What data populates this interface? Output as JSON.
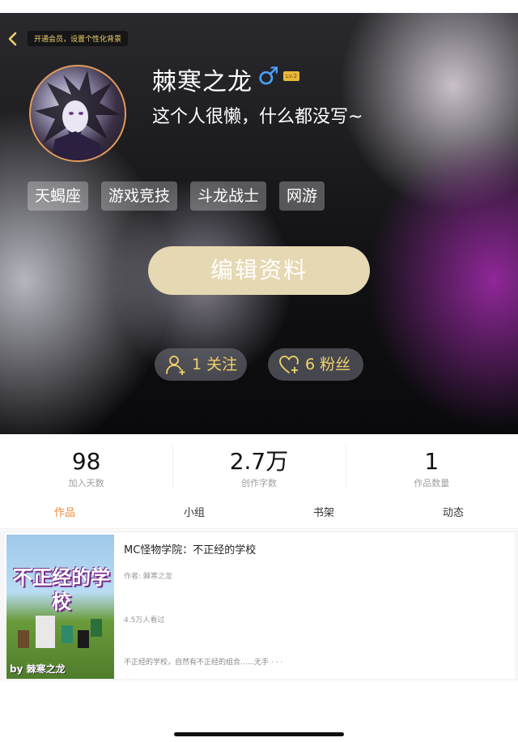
{
  "header": {
    "vip_tip": "开通会员，设置个性化背景",
    "nickname": "棘寒之龙",
    "level": "Lv.2",
    "signature": "这个人很懒，什么都没写~",
    "tags": [
      "天蝎座",
      "游戏竞技",
      "斗龙战士",
      "网游"
    ],
    "edit_button": "编辑资料",
    "follow_label": "1 关注",
    "fans_label": "6 粉丝",
    "accent_color": "#f1d36b"
  },
  "stats": [
    {
      "value": "98",
      "label": "加入天数"
    },
    {
      "value": "2.7万",
      "label": "创作字数"
    },
    {
      "value": "1",
      "label": "作品数量"
    }
  ],
  "tabs": [
    "作品",
    "小组",
    "书架",
    "动态"
  ],
  "active_tab": "作品",
  "works": [
    {
      "title": "MC怪物学院：不正经的学校",
      "author": "作者: 棘寒之龙",
      "views": "4.5万人看过",
      "description": "不正经的学校，自然有不正经的组合......无手 · · ·",
      "cover_title": "不正经的学校",
      "cover_author": "by 棘寒之龙"
    }
  ],
  "icons": {
    "back": "chevron-left-icon",
    "gender": "male-icon",
    "follow": "add-user-icon",
    "fans": "heart-plus-icon"
  }
}
